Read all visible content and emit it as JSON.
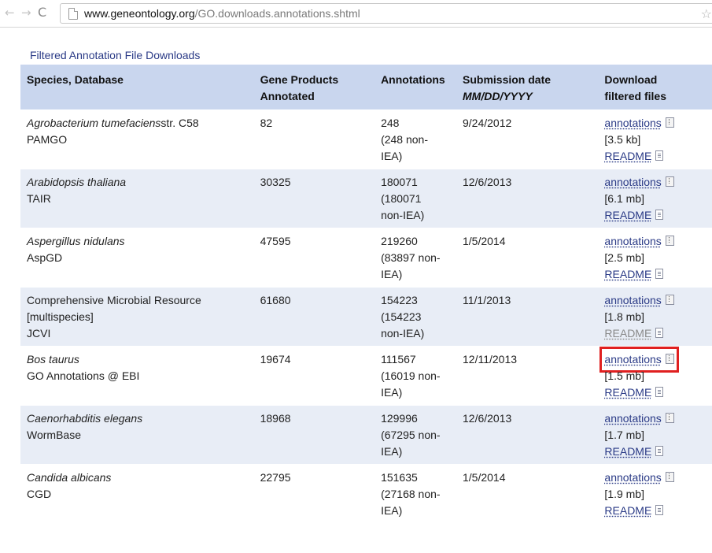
{
  "browser": {
    "back": "←",
    "forward": "→",
    "reload": "C",
    "url_host": "www.geneontology.org",
    "url_path": "/GO.downloads.annotations.shtml",
    "star": "☆"
  },
  "section_title": "Filtered Annotation File Downloads",
  "table": {
    "headers": {
      "species": "Species, Database",
      "gene_products_1": "Gene Products",
      "gene_products_2": "Annotated",
      "annotations": "Annotations",
      "submission_1": "Submission date",
      "submission_2": "MM/DD/YYYY",
      "download_1": "Download",
      "download_2": "filtered files"
    },
    "rows": [
      {
        "species": "Agrobacterium tumefaciens",
        "species_suffix": "str. C58",
        "db": "PAMGO",
        "gene_products": "82",
        "annotations": "248",
        "non_iea_1": "(248 non-",
        "non_iea_2": "IEA)",
        "date": "9/24/2012",
        "link": "annotations",
        "size": "[3.5 kb]",
        "readme": "README"
      },
      {
        "species": "Arabidopsis thaliana",
        "species_suffix": "",
        "db": "TAIR",
        "gene_products": "30325",
        "annotations": "180071",
        "non_iea_1": "(180071",
        "non_iea_2": "non-IEA)",
        "date": "12/6/2013",
        "link": "annotations",
        "size": "[6.1 mb]",
        "readme": "README"
      },
      {
        "species": "Aspergillus nidulans",
        "species_suffix": "",
        "db": "AspGD",
        "gene_products": "47595",
        "annotations": "219260",
        "non_iea_1": "(83897 non-",
        "non_iea_2": "IEA)",
        "date": "1/5/2014",
        "link": "annotations",
        "size": "[2.5 mb]",
        "readme": "README"
      },
      {
        "species_plain_1": "Comprehensive Microbial Resource",
        "species_plain_2": "[multispecies]",
        "db": "JCVI",
        "gene_products": "61680",
        "annotations": "154223",
        "non_iea_1": "(154223",
        "non_iea_2": "non-IEA)",
        "date": "11/1/2013",
        "link": "annotations",
        "size": "[1.8 mb]",
        "readme": "README"
      },
      {
        "species": "Bos taurus",
        "species_suffix": "",
        "db": "GO Annotations @ EBI",
        "gene_products": "19674",
        "annotations": "111567",
        "non_iea_1": "(16019 non-",
        "non_iea_2": "IEA)",
        "date": "12/11/2013",
        "link": "annotations",
        "size": "[1.5 mb]",
        "readme": "README"
      },
      {
        "species": "Caenorhabditis elegans",
        "species_suffix": "",
        "db": "WormBase",
        "gene_products": "18968",
        "annotations": "129996",
        "non_iea_1": "(67295 non-",
        "non_iea_2": "IEA)",
        "date": "12/6/2013",
        "link": "annotations",
        "size": "[1.7 mb]",
        "readme": "README"
      },
      {
        "species": "Candida albicans",
        "species_suffix": "",
        "db": "CGD",
        "gene_products": "22795",
        "annotations": "151635",
        "non_iea_1": "(27168 non-",
        "non_iea_2": "IEA)",
        "date": "1/5/2014",
        "link": "annotations",
        "size": "[1.9 mb]",
        "readme": "README"
      }
    ]
  },
  "colors": {
    "header_bg": "#c9d6ee",
    "alt_row_bg": "#e8edf6",
    "link": "#2a3a86",
    "highlight": "#e02020"
  }
}
